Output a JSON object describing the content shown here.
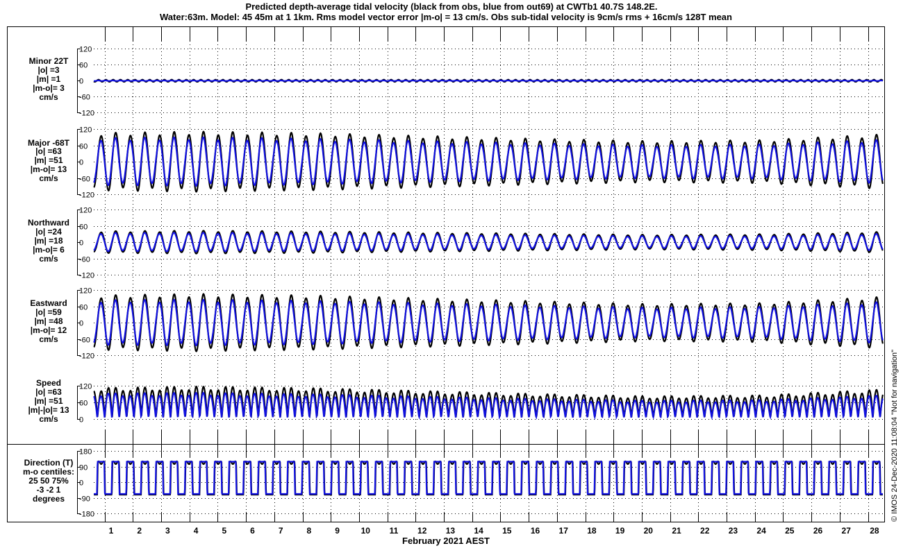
{
  "chart_data": {
    "type": "line",
    "title": "Predicted depth-average tidal velocity (black from obs, blue from out69) at CWTb1 40.7S 148.2E.",
    "subtitle": "Water:63m. Model: 45 45m at 1 1km. Rms model vector error |m-o| = 13 cm/s. Obs sub-tidal velocity is 9cm/s rms + 16cm/s 128T mean",
    "xlabel": "February 2021 AEST",
    "xlim": [
      0.39,
      28.3
    ],
    "x_ticks": [
      "1",
      "2",
      "3",
      "4",
      "5",
      "6",
      "7",
      "8",
      "9",
      "10",
      "11",
      "12",
      "13",
      "14",
      "15",
      "16",
      "17",
      "18",
      "19",
      "20",
      "21",
      "22",
      "23",
      "24",
      "25",
      "26",
      "27",
      "28"
    ],
    "series_colors": {
      "obs": "#000000",
      "model": "#1010e0"
    },
    "tidal_period_days": 0.5175,
    "envelope_days": [
      0.4,
      4,
      8,
      12,
      16,
      20,
      24,
      28.3
    ],
    "panels": [
      {
        "key": "minor",
        "labels": [
          "Minor 22T",
          "|o| =3",
          "|m| =1",
          "|m-o|= 3",
          "cm/s"
        ],
        "ylim": [
          -120,
          120
        ],
        "yticks": [
          "120",
          "60",
          "0",
          "-60",
          "-120"
        ],
        "obs_amp": [
          4,
          4,
          4,
          4,
          4,
          4,
          4,
          4
        ],
        "model_amp": [
          1,
          1,
          1,
          1,
          1,
          1,
          1,
          1
        ]
      },
      {
        "key": "major",
        "labels": [
          "Major -68T",
          "|o| =63",
          "|m| =51",
          "|m-o|= 13",
          "cm/s"
        ],
        "ylim": [
          -120,
          120
        ],
        "yticks": [
          "120",
          "60",
          "0",
          "-60",
          "-120"
        ],
        "obs_amp": [
          100,
          105,
          100,
          90,
          80,
          72,
          75,
          95
        ],
        "model_amp": [
          82,
          85,
          80,
          72,
          64,
          58,
          60,
          76
        ]
      },
      {
        "key": "northward",
        "labels": [
          "Northward",
          "|o| =24",
          "|m| =18",
          "|m-o|= 6",
          "cm/s"
        ],
        "ylim": [
          -120,
          120
        ],
        "yticks": [
          "120",
          "60",
          "0",
          "-60",
          "-120"
        ],
        "obs_amp": [
          38,
          40,
          38,
          34,
          30,
          26,
          28,
          36
        ],
        "model_amp": [
          32,
          33,
          31,
          28,
          24,
          21,
          22,
          29
        ]
      },
      {
        "key": "eastward",
        "labels": [
          "Eastward",
          "|o| =59",
          "|m| =48",
          "|m-o|= 12",
          "cm/s"
        ],
        "ylim": [
          -120,
          120
        ],
        "yticks": [
          "120",
          "60",
          "0",
          "-60",
          "-120"
        ],
        "obs_amp": [
          95,
          100,
          95,
          85,
          75,
          65,
          68,
          90
        ],
        "model_amp": [
          78,
          80,
          76,
          68,
          60,
          52,
          55,
          72
        ]
      },
      {
        "key": "speed",
        "labels": [
          "Speed",
          "|o| =63",
          "|m| =51",
          "|m|-|o|= 13",
          "cm/s"
        ],
        "ylim": [
          0,
          120
        ],
        "yticks": [
          "120",
          "60",
          "0"
        ],
        "obs_amp": [
          100,
          105,
          100,
          90,
          80,
          60,
          62,
          95
        ],
        "model_amp": [
          82,
          85,
          80,
          72,
          64,
          50,
          52,
          76
        ]
      },
      {
        "key": "direction",
        "labels": [
          "Direction (T)",
          "m-o centiles:",
          "25  50  75%",
          "-3 -2  1",
          "degrees"
        ],
        "ylim": [
          -180,
          180
        ],
        "yticks": [
          "180",
          "90",
          "0",
          "-90",
          "-180"
        ],
        "obs_levels": [
          112,
          -68
        ],
        "model_levels": [
          112,
          -68
        ]
      }
    ],
    "credit": "© IMOS 24-Dec-2020 11:08:04  \"Not for navigation\""
  }
}
